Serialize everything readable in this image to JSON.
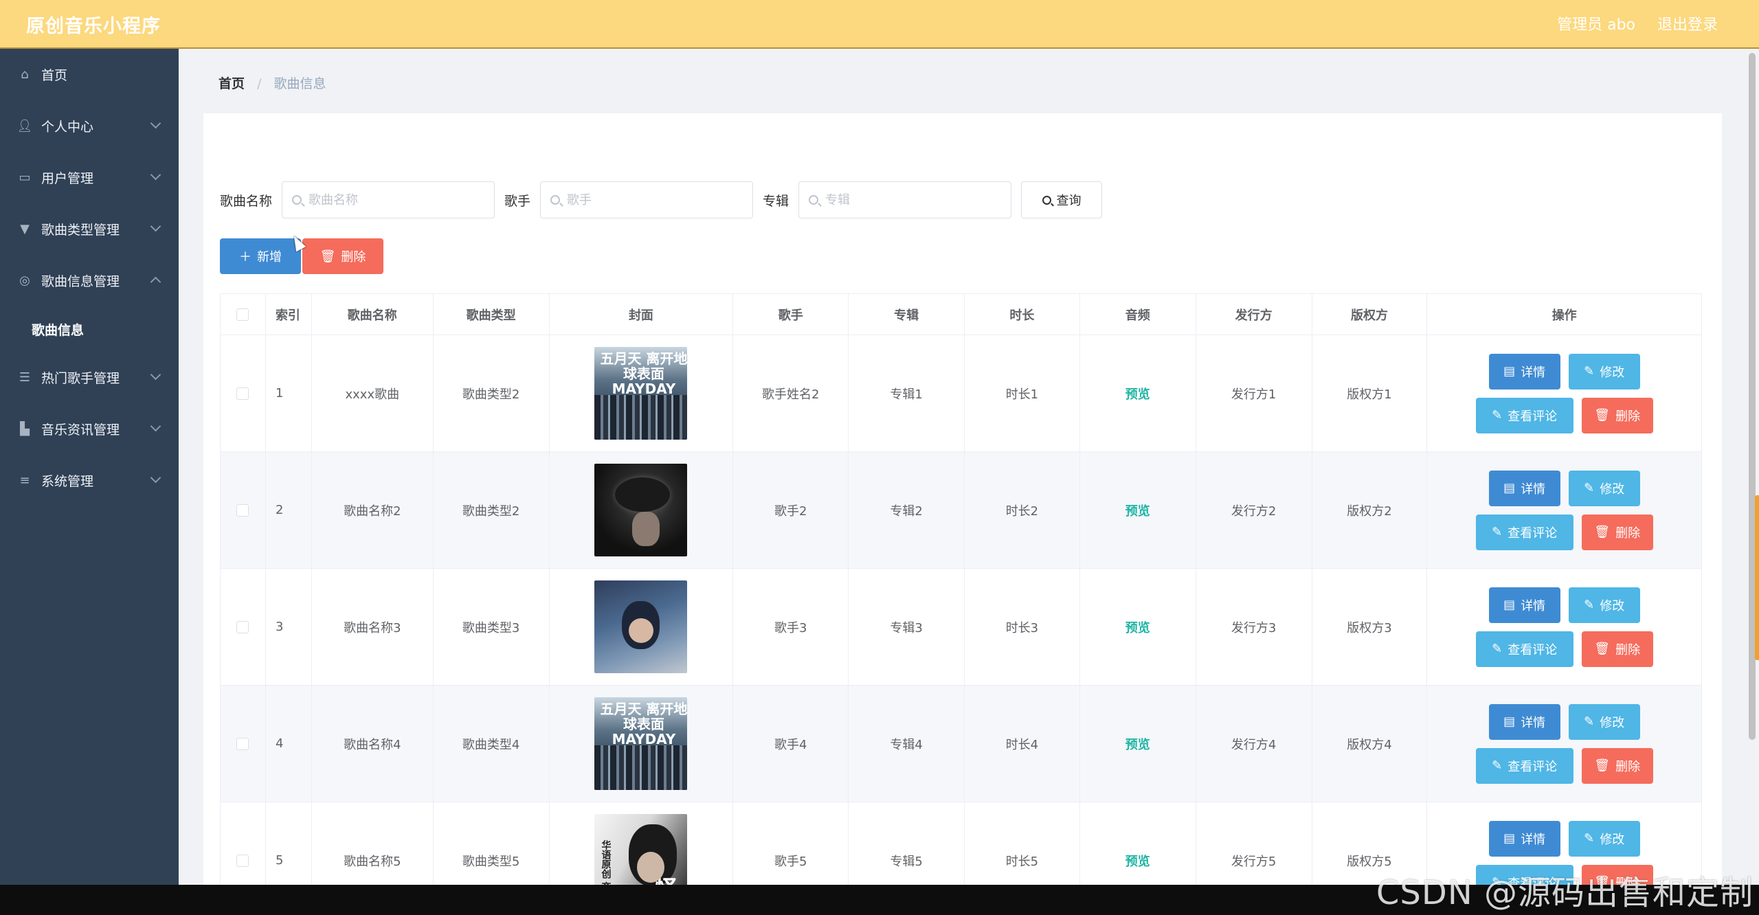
{
  "header": {
    "title": "原创音乐小程序",
    "user": "管理员 abo",
    "logout": "退出登录"
  },
  "sidebar": {
    "items": [
      {
        "label": "首页",
        "icon": "home-icon"
      },
      {
        "label": "个人中心",
        "icon": "user-icon"
      },
      {
        "label": "用户管理",
        "icon": "id-card-icon"
      },
      {
        "label": "歌曲类型管理",
        "icon": "brush-icon"
      },
      {
        "label": "歌曲信息管理",
        "icon": "disc-icon",
        "expanded": true,
        "children": [
          {
            "label": "歌曲信息"
          }
        ]
      },
      {
        "label": "热门歌手管理",
        "icon": "sliders-icon"
      },
      {
        "label": "音乐资讯管理",
        "icon": "thumb-icon"
      },
      {
        "label": "系统管理",
        "icon": "menu-icon"
      }
    ]
  },
  "breadcrumb": {
    "home": "首页",
    "sep": "/",
    "current": "歌曲信息"
  },
  "search": {
    "name_label": "歌曲名称",
    "name_placeholder": "歌曲名称",
    "singer_label": "歌手",
    "singer_placeholder": "歌手",
    "album_label": "专辑",
    "album_placeholder": "专辑",
    "query_label": "查询"
  },
  "actions": {
    "add_label": "新增",
    "delete_label": "删除"
  },
  "table": {
    "headers": [
      "索引",
      "歌曲名称",
      "歌曲类型",
      "封面",
      "歌手",
      "专辑",
      "时长",
      "音频",
      "发行方",
      "版权方",
      "操作"
    ],
    "rows": [
      {
        "index": "1",
        "name": "xxxx歌曲",
        "type": "歌曲类型2",
        "cover": "a",
        "singer": "歌手姓名2",
        "album": "专辑1",
        "duration": "时长1",
        "audio": "预览",
        "publisher": "发行方1",
        "copyright": "版权方1"
      },
      {
        "index": "2",
        "name": "歌曲名称2",
        "type": "歌曲类型2",
        "cover": "b",
        "singer": "歌手2",
        "album": "专辑2",
        "duration": "时长2",
        "audio": "预览",
        "publisher": "发行方2",
        "copyright": "版权方2"
      },
      {
        "index": "3",
        "name": "歌曲名称3",
        "type": "歌曲类型3",
        "cover": "c",
        "singer": "歌手3",
        "album": "专辑3",
        "duration": "时长3",
        "audio": "预览",
        "publisher": "发行方3",
        "copyright": "版权方3"
      },
      {
        "index": "4",
        "name": "歌曲名称4",
        "type": "歌曲类型4",
        "cover": "a",
        "singer": "歌手4",
        "album": "专辑4",
        "duration": "时长4",
        "audio": "预览",
        "publisher": "发行方4",
        "copyright": "版权方4"
      },
      {
        "index": "5",
        "name": "歌曲名称5",
        "type": "歌曲类型5",
        "cover": "d",
        "singer": "歌手5",
        "album": "专辑5",
        "duration": "时长5",
        "audio": "预览",
        "publisher": "发行方5",
        "copyright": "版权方5"
      }
    ],
    "op_labels": {
      "detail": "详情",
      "edit": "修改",
      "review": "查看评论",
      "delete": "删除"
    }
  },
  "cover_text": {
    "a": "五月天 离开地球表面 MAYDAY",
    "d_small": "华语原创 齐天",
    "d_big": "怪"
  },
  "watermark": "CSDN @源码出售和定制",
  "colors": {
    "topbar": "#fcd87e",
    "sidebar": "#304156",
    "primary": "#3f8bd3",
    "info": "#4fb6e6",
    "danger": "#f56c5c",
    "preview": "#1fb5a4"
  }
}
